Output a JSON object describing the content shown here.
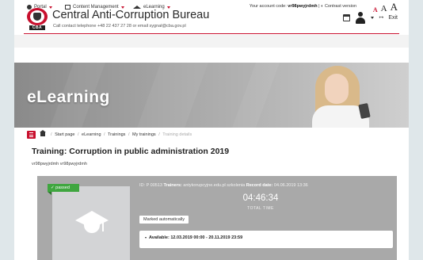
{
  "header": {
    "site_title": "Central Anti-Corruption Bureau",
    "contact": "Call contact telephone +48 22 437 27 28 or email sygnał@cba.gov.pl",
    "logo_tag": "CBA",
    "exit_label": "Exit"
  },
  "account": {
    "label": "Your account code:",
    "code": "vr98pwyjrdmh",
    "separator": "|",
    "contrast": "Contrast version",
    "font_small": "A",
    "font_medium": "A",
    "font_large": "A"
  },
  "nav": {
    "items": [
      {
        "label": "Portal",
        "icon": "globe-icon"
      },
      {
        "label": "Content Management",
        "icon": "edit-icon"
      },
      {
        "label": "eLearning",
        "icon": "graduation-cap-icon"
      }
    ]
  },
  "banner": {
    "title": "eLearning"
  },
  "breadcrumb": {
    "items": [
      "Start page",
      "eLearning",
      "Trainings",
      "My trainings"
    ],
    "current": "Training details",
    "separator": "/"
  },
  "training": {
    "title": "Training: Corruption in public administration 2019",
    "user": "vr98pwyjrdmh vr98pwyjrdmh",
    "status_badge": "passed",
    "id_label": "ID:",
    "id_value": "P 00513",
    "trainers_label": "Trainers:",
    "trainers_value": "antykorupcyjne.edu.pl szkolenia",
    "record_label": "Record date:",
    "record_value": "04.06.2019 13:36",
    "total_time": "04:46:34",
    "total_time_label": "TOTAL TIME",
    "marked_label": "Marked automatically",
    "available_label": "Available:",
    "available_value": "12.03.2019 00:00 - 20.11.2019 23:59"
  },
  "colors": {
    "accent_red": "#c8102e",
    "passed_green": "#3fa63f",
    "card_gray": "#a9a9a9"
  }
}
